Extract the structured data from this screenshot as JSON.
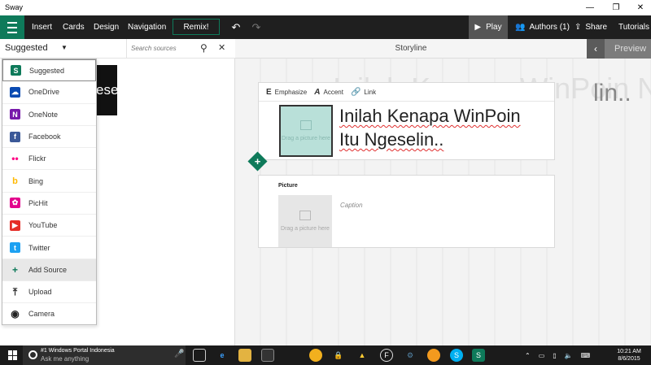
{
  "window": {
    "title": "Sway",
    "minimize": "—",
    "maximize": "❐",
    "close": "✕"
  },
  "toolbar": {
    "menu": [
      "Insert",
      "Cards",
      "Design",
      "Navigation"
    ],
    "remix": "Remix!",
    "undo": "↶",
    "redo": "↷",
    "play": "Play",
    "authors": "Authors (1)",
    "share": "Share",
    "tutorials": "Tutorials"
  },
  "sources": {
    "selected": "Suggested",
    "search_placeholder": "Search sources",
    "thumb_text": "eselin..",
    "items": [
      {
        "label": "Suggested",
        "icon": "sway-icon",
        "glyph": "S",
        "color": "#0e7a5a"
      },
      {
        "label": "OneDrive",
        "icon": "onedrive-icon",
        "glyph": "☁",
        "color": "#094ab2"
      },
      {
        "label": "OneNote",
        "icon": "onenote-icon",
        "glyph": "N",
        "color": "#7719aa"
      },
      {
        "label": "Facebook",
        "icon": "facebook-icon",
        "glyph": "f",
        "color": "#3b5998"
      },
      {
        "label": "Flickr",
        "icon": "flickr-icon",
        "glyph": "••",
        "color": "#ffffff"
      },
      {
        "label": "Bing",
        "icon": "bing-icon",
        "glyph": "b",
        "color": "#ffb900"
      },
      {
        "label": "PicHit",
        "icon": "pichit-icon",
        "glyph": "✿",
        "color": "#e3008c"
      },
      {
        "label": "YouTube",
        "icon": "youtube-icon",
        "glyph": "▶",
        "color": "#e52d27"
      },
      {
        "label": "Twitter",
        "icon": "twitter-icon",
        "glyph": "t",
        "color": "#1da1f2"
      },
      {
        "label": "Add Source",
        "icon": "plus-icon",
        "glyph": "+",
        "color": "#0e7a5a"
      },
      {
        "label": "Upload",
        "icon": "upload-icon",
        "glyph": "⤒",
        "color": "#222222"
      },
      {
        "label": "Camera",
        "icon": "camera-icon",
        "glyph": "◉",
        "color": "#222222"
      }
    ]
  },
  "storyline": {
    "header": "Storyline",
    "preview": "Preview",
    "ghost_title": "Inilah Kenapa WinPoin Ngeselin..",
    "ghost_right": "lin..",
    "title_card": {
      "format": [
        "Emphasize",
        "Accent",
        "Link"
      ],
      "heading_line1": "Inilah Kenapa WinPoin",
      "heading_line2": "Itu Ngeselin..",
      "drop_text": "Drag a picture here"
    },
    "picture_card": {
      "label": "Picture",
      "drop_text": "Drag a picture here",
      "caption": "Caption"
    }
  },
  "taskbar": {
    "news": "#1 Windows Portal Indonesia",
    "ask": "Ask me anything",
    "time": "10:21 AM",
    "date": "8/6/2015"
  },
  "colors": {
    "accent": "#0e7a5a",
    "toolbar": "#1f1f1f"
  }
}
